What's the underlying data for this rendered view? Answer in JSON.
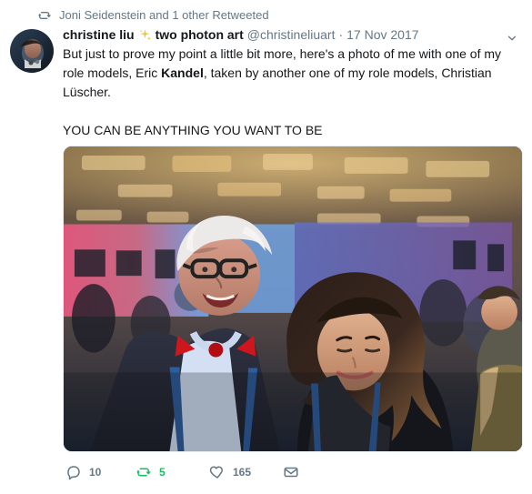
{
  "retweet_context": {
    "text": "Joni Seidenstein and 1 other Retweeted",
    "icon": "retweet-icon"
  },
  "author": {
    "name_before": "christine liu",
    "name_after": "two photon art",
    "handle": "@christineliuart",
    "separator": "·",
    "date": "17 Nov 2017",
    "avatar_icon": "avatar-icon",
    "sparkle_icon": "sparkle-icon"
  },
  "tweet": {
    "segments": [
      {
        "text": "But just to prove my point a little bit more, here's a photo of me with one of my role models, Eric "
      },
      {
        "text": "Kandel",
        "bold": true
      },
      {
        "text": ", taken by another one of my role models, Christian Lüscher."
      }
    ],
    "last_paragraph": "YOU CAN BE ANYTHING YOU WANT TO BE"
  },
  "actions": {
    "reply_count": "10",
    "retweet_count": "5",
    "like_count": "165"
  },
  "colors": {
    "text": "#14171a",
    "secondary": "#657786",
    "retweet_green": "#17bf63",
    "border": "#e6ecf0"
  }
}
